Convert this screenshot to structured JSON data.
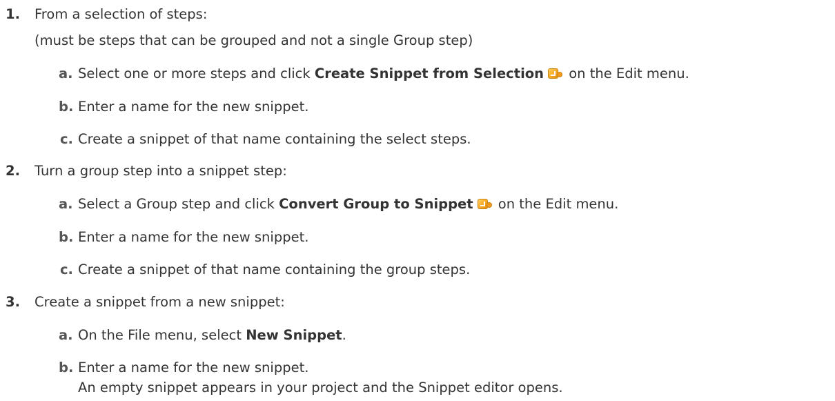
{
  "steps": [
    {
      "number": "1.",
      "text": "From a selection of steps:",
      "note": "(must be steps that can be grouped and not a single Group step)",
      "substeps": [
        {
          "letter": "a.",
          "pre": "Select one or more steps and click ",
          "bold": "Create Snippet from Selection",
          "icon": "snippet-icon",
          "post": " on the Edit menu."
        },
        {
          "letter": "b.",
          "text": "Enter a name for the new snippet."
        },
        {
          "letter": "c.",
          "text": "Create a snippet of that name containing the select steps."
        }
      ]
    },
    {
      "number": "2.",
      "text": "Turn a group step into a snippet step:",
      "substeps": [
        {
          "letter": "a.",
          "pre": "Select a Group step and click ",
          "bold": "Convert Group to Snippet",
          "icon": "snippet-icon",
          "post": " on the Edit menu."
        },
        {
          "letter": "b.",
          "text": "Enter a name for the new snippet."
        },
        {
          "letter": "c.",
          "text": "Create a snippet of that name containing the group steps."
        }
      ]
    },
    {
      "number": "3.",
      "text": "Create a snippet from a new snippet:",
      "substeps": [
        {
          "letter": "a.",
          "pre": "On the File menu, select ",
          "bold": "New Snippet",
          "post": "."
        },
        {
          "letter": "b.",
          "text": "Enter a name for the new snippet.",
          "note": "An empty snippet appears in your project and the Snippet editor opens."
        }
      ]
    }
  ]
}
